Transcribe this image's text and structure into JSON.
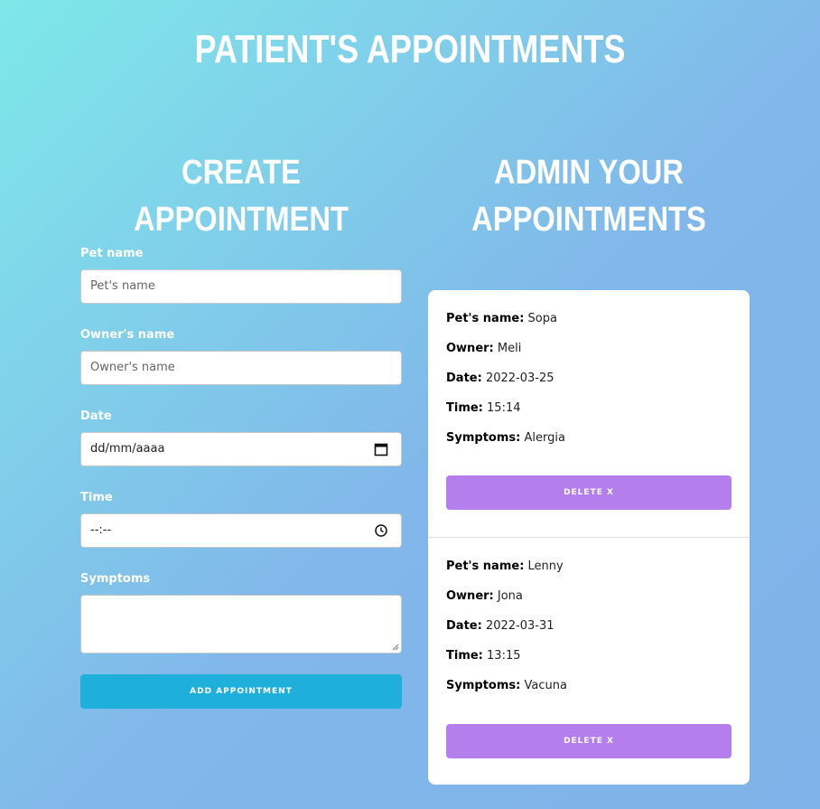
{
  "header": {
    "title": "PATIENT'S APPOINTMENTS"
  },
  "create": {
    "title": "CREATE APPOINTMENT",
    "fields": [
      {
        "label": "Pet name",
        "placeholder": "Pet's name",
        "value": ""
      },
      {
        "label": "Owner's name",
        "placeholder": "Owner's name",
        "value": ""
      },
      {
        "label": "Date",
        "value": "dd/mm/aaaa",
        "icon": "calendar-icon"
      },
      {
        "label": "Time",
        "value": "--:--",
        "icon": "clock-icon"
      },
      {
        "label": "Symptoms",
        "value": ""
      }
    ],
    "submit_label": "ADD APPOINTMENT",
    "submit_color": "#1eafdb"
  },
  "admin": {
    "title": "ADMIN YOUR APPOINTMENTS",
    "labels": {
      "pet": "Pet's name:",
      "owner": "Owner:",
      "date": "Date:",
      "time": "Time:",
      "symptoms": "Symptoms:"
    },
    "appointments": [
      {
        "pet": "Sopa",
        "owner": "Meli",
        "date": "2022-03-25",
        "time": "15:14",
        "symptoms": "Alergia",
        "delete_label": "DELETE x"
      },
      {
        "pet": "Lenny",
        "owner": "Jona",
        "date": "2022-03-31",
        "time": "13:15",
        "symptoms": "Vacuna",
        "delete_label": "DELETE x"
      }
    ],
    "delete_color": "#b47eec"
  }
}
